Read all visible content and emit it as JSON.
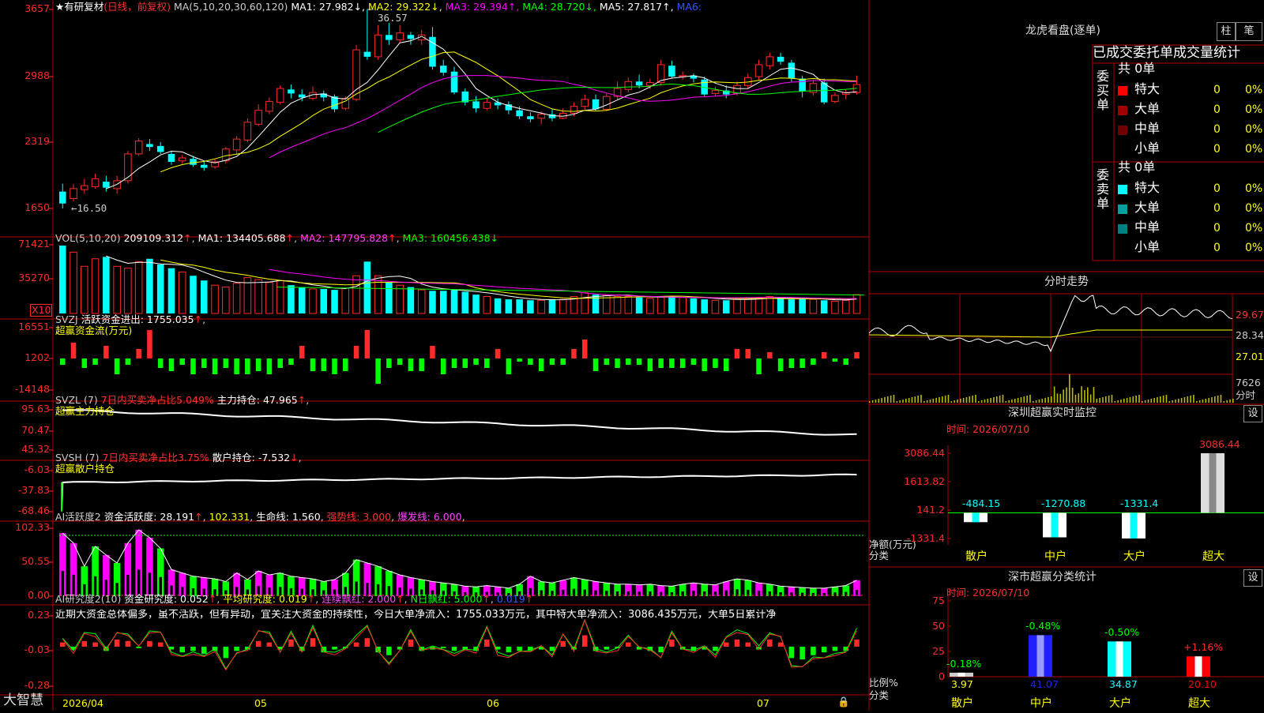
{
  "app": {
    "brand": "大智慧"
  },
  "colors": {
    "up": "#ff2a2a",
    "down": "#00ffff",
    "frame": "#b00000",
    "text": "#c0c0c0",
    "yellow": "#ffff00",
    "magenta": "#ff00ff",
    "green": "#00ff00",
    "white": "#ffffff"
  },
  "kline": {
    "title": "★有研复材",
    "subtitle": "(日线，前复权)",
    "ma_params": "MA(5,10,20,30,60,120)",
    "ma": [
      {
        "label": "MA1: 27.982",
        "arrow": "↓",
        "color": "#ffffff"
      },
      {
        "label": "MA2: 29.322",
        "arrow": "↓",
        "color": "#ffff00"
      },
      {
        "label": "MA3: 29.394",
        "arrow": "↑",
        "color": "#ff00ff"
      },
      {
        "label": "MA4: 28.720",
        "arrow": "↓",
        "color": "#00ff00"
      },
      {
        "label": "MA5: 27.817",
        "arrow": "↑",
        "color": "#ffffff"
      },
      {
        "label": "MA6:",
        "arrow": "",
        "color": "#3355ff"
      }
    ],
    "y_labels": [
      "3657",
      "2988",
      "2319",
      "1650"
    ],
    "high_mark": "36.57",
    "low_mark": "←16.50"
  },
  "vol": {
    "header": "VOL(5,10,20)",
    "value": "209109.312",
    "ma1": "MA1: 134405.688",
    "ma2": "MA2: 147795.828",
    "ma3": "MA3: 160456.438",
    "y_labels": [
      "71421",
      "35270"
    ],
    "unit": "X10"
  },
  "svzj": {
    "header": "SVZJ",
    "item": "活跃资金进出: 1755.035",
    "sub": "超赢资金流(万元)",
    "y_labels": [
      "16551",
      "1202",
      "-14148"
    ]
  },
  "svzl": {
    "header": "SVZL (7)",
    "item1": "7日内买卖净占比5.049%",
    "item2": "主力持仓: 47.965",
    "sub": "超赢主力持仓",
    "y_labels": [
      "95.63",
      "70.47",
      "45.32"
    ]
  },
  "svsh": {
    "header": "SVSH (7)",
    "item1": "7日内买卖净占比3.75%",
    "item2": "散户持仓: -7.532",
    "sub": "超赢散户持仓",
    "y_labels": [
      "-6.03",
      "-37.83",
      "-68.46"
    ]
  },
  "ai1": {
    "header": "AI活跃度2",
    "item1": "资金活跃度: 28.191",
    "item2": "102.331",
    "item3": "生命线: 1.560",
    "item4": "强势线: 3.000",
    "item5": "爆发线: 6.000",
    "y_labels": [
      "102.33",
      "50.55",
      "0.00"
    ]
  },
  "ai2": {
    "header": "AI研究度2(10)",
    "item1": "资金研究度: 0.052",
    "item2": "平均研究度: 0.019",
    "item3": "连续飘红: 2.000",
    "item4": "N日飘红: 5.000",
    "item5": "0.019",
    "comment": "近期大资金总体偏多，虽不活跃，但有异动，宜关注大资金的持续性，今日大单净流入：1755.033万元，其中特大单净流入：3086.435万元，大单5日累计净",
    "y_labels": [
      "0.23",
      "-0.03",
      "-0.28"
    ]
  },
  "xaxis": {
    "labels": [
      "2026/04",
      "05",
      "06",
      "07"
    ]
  },
  "lhb": {
    "title": "龙虎看盘(逐单)",
    "tabs": [
      "柱",
      "笔"
    ],
    "header": "已成交委托单成交量统计",
    "buy": {
      "label": "委买单",
      "total": "共 0单",
      "rows": [
        {
          "name": "特大",
          "count": "0",
          "pct": "0%",
          "color": "#ff0000"
        },
        {
          "name": "大单",
          "count": "0",
          "pct": "0%",
          "color": "#a00000"
        },
        {
          "name": "中单",
          "count": "0",
          "pct": "0%",
          "color": "#700000"
        },
        {
          "name": "小单",
          "count": "0",
          "pct": "0%",
          "color": ""
        }
      ]
    },
    "sell": {
      "label": "委卖单",
      "total": "共 0单",
      "rows": [
        {
          "name": "特大",
          "count": "0",
          "pct": "0%",
          "color": "#00ffff"
        },
        {
          "name": "大单",
          "count": "0",
          "pct": "0%",
          "color": "#00a0a0"
        },
        {
          "name": "中单",
          "count": "0",
          "pct": "0%",
          "color": "#008080"
        },
        {
          "name": "小单",
          "count": "0",
          "pct": "0%",
          "color": ""
        }
      ]
    }
  },
  "fenshi": {
    "title": "分时走势",
    "y_labels": [
      "29.67",
      "28.34",
      "27.01"
    ],
    "vol_label": "7626",
    "unit": "分时"
  },
  "sz_monitor": {
    "title": "深圳超赢实时监控",
    "set": "设",
    "time": "时间: 2026/07/10",
    "y_labels": [
      "3086.44",
      "1613.82",
      "141.2",
      "-1331.4"
    ],
    "ylabel": "净额(万元)",
    "xlabel": "分类",
    "categories": [
      "散户",
      "中户",
      "大户",
      "超大"
    ],
    "values": [
      -484.15,
      -1270.88,
      -1331.4,
      3086.44
    ],
    "value_labels": [
      "-484.15",
      "-1270.88",
      "-1331.4",
      "3086.44"
    ]
  },
  "sz_stats": {
    "title": "深市超赢分类统计",
    "set": "设",
    "time": "时间: 2026/07/10",
    "y_labels": [
      "75",
      "50",
      "25",
      "0"
    ],
    "ylabel": "比例%",
    "xlabel": "分类",
    "categories": [
      "散户",
      "中户",
      "大户",
      "超大"
    ],
    "values": [
      3.97,
      41.07,
      34.87,
      20.1
    ],
    "value_labels": [
      "3.97",
      "41.07",
      "34.87",
      "20.10"
    ],
    "change_labels": [
      "-0.18%",
      "-0.48%",
      "-0.50%",
      "+1.16%"
    ],
    "bar_colors": [
      "#cccccc",
      "#2020ff",
      "#00ffff",
      "#ff0000"
    ]
  },
  "chart_data": [
    {
      "type": "candlestick",
      "title": "★有研复材",
      "ylim": [
        16.5,
        36.57
      ],
      "candles": [
        [
          18.2,
          17.0,
          19.0,
          16.5
        ],
        [
          17.5,
          18.5,
          19.0,
          17.2
        ],
        [
          18.4,
          18.8,
          19.5,
          18.0
        ],
        [
          18.7,
          19.5,
          20.0,
          18.5
        ],
        [
          19.2,
          18.6,
          19.8,
          18.2
        ],
        [
          18.5,
          19.3,
          19.8,
          18.0
        ],
        [
          19.3,
          22.0,
          22.3,
          19.0
        ],
        [
          22.0,
          23.3,
          23.6,
          21.8
        ],
        [
          23.0,
          22.7,
          23.5,
          22.3
        ],
        [
          22.8,
          22.2,
          23.2,
          22.0
        ],
        [
          22.0,
          21.2,
          22.3,
          20.9
        ],
        [
          21.3,
          21.6,
          21.9,
          21.0
        ],
        [
          21.5,
          20.9,
          21.8,
          20.7
        ],
        [
          20.9,
          20.6,
          21.3,
          20.3
        ],
        [
          20.7,
          21.2,
          21.5,
          20.5
        ],
        [
          21.3,
          22.5,
          22.7,
          21.0
        ],
        [
          22.4,
          23.5,
          23.8,
          22.0
        ],
        [
          23.4,
          25.2,
          25.6,
          23.2
        ],
        [
          25.0,
          26.4,
          27.0,
          24.8
        ],
        [
          26.3,
          27.3,
          27.7,
          26.0
        ],
        [
          27.2,
          28.6,
          28.9,
          27.0
        ],
        [
          28.5,
          28.1,
          29.0,
          27.6
        ],
        [
          28.0,
          27.7,
          28.5,
          27.3
        ],
        [
          27.6,
          28.2,
          28.8,
          27.4
        ],
        [
          28.1,
          27.7,
          28.4,
          27.3
        ],
        [
          27.8,
          26.5,
          28.0,
          26.2
        ],
        [
          26.6,
          27.6,
          27.8,
          26.4
        ],
        [
          27.5,
          32.5,
          33.0,
          27.3
        ],
        [
          32.3,
          31.8,
          36.57,
          31.5
        ],
        [
          31.8,
          34.0,
          35.0,
          31.5
        ],
        [
          34.0,
          33.5,
          35.2,
          33.0
        ],
        [
          33.5,
          34.2,
          35.0,
          33.2
        ],
        [
          34.0,
          33.6,
          34.3,
          33.0
        ],
        [
          33.5,
          34.0,
          34.5,
          33.0
        ],
        [
          33.8,
          30.8,
          34.8,
          30.5
        ],
        [
          30.9,
          30.2,
          31.5,
          29.9
        ],
        [
          30.3,
          28.2,
          30.8,
          28.0
        ],
        [
          28.3,
          27.2,
          28.6,
          26.9
        ],
        [
          27.3,
          26.6,
          27.8,
          26.2
        ],
        [
          26.6,
          27.2,
          27.6,
          26.4
        ],
        [
          27.2,
          26.9,
          27.6,
          26.5
        ],
        [
          27.0,
          26.4,
          27.3,
          26.0
        ],
        [
          26.4,
          25.8,
          26.8,
          25.5
        ],
        [
          25.8,
          25.5,
          26.2,
          25.2
        ],
        [
          25.6,
          26.0,
          26.3,
          25.0
        ],
        [
          26.0,
          25.6,
          26.5,
          25.3
        ],
        [
          25.6,
          26.1,
          26.6,
          25.5
        ],
        [
          26.1,
          26.8,
          27.2,
          25.8
        ],
        [
          26.8,
          27.5,
          28.0,
          26.5
        ],
        [
          27.5,
          26.5,
          28.0,
          26.3
        ],
        [
          26.5,
          27.8,
          28.1,
          26.3
        ],
        [
          27.8,
          28.6,
          29.3,
          27.5
        ],
        [
          28.5,
          29.3,
          29.7,
          28.2
        ],
        [
          29.3,
          28.9,
          30.0,
          28.6
        ],
        [
          28.9,
          29.2,
          29.6,
          28.5
        ],
        [
          29.2,
          31.0,
          31.5,
          28.9
        ],
        [
          30.9,
          29.8,
          31.4,
          29.6
        ],
        [
          29.8,
          29.9,
          30.3,
          29.5
        ],
        [
          29.9,
          29.6,
          30.1,
          29.2
        ],
        [
          29.5,
          28.0,
          29.8,
          27.8
        ],
        [
          28.1,
          28.4,
          28.8,
          27.8
        ],
        [
          28.4,
          28.0,
          28.9,
          27.6
        ],
        [
          28.1,
          28.9,
          29.3,
          27.9
        ],
        [
          28.9,
          29.7,
          30.1,
          28.6
        ],
        [
          29.8,
          31.0,
          31.5,
          29.5
        ],
        [
          30.9,
          31.8,
          32.2,
          30.5
        ],
        [
          31.8,
          31.3,
          32.2,
          31.0
        ],
        [
          31.2,
          29.6,
          31.5,
          29.3
        ],
        [
          29.6,
          28.3,
          29.9,
          27.7
        ],
        [
          28.2,
          29.1,
          29.5,
          27.9
        ],
        [
          29.2,
          27.2,
          29.6,
          27.0
        ],
        [
          27.3,
          27.9,
          28.2,
          27.1
        ],
        [
          28.0,
          28.2,
          28.5,
          27.5
        ],
        [
          28.2,
          29.0,
          29.9,
          28.0
        ]
      ]
    },
    {
      "type": "bar",
      "title": "VOL(5,10,20)",
      "ylim": [
        0,
        71421
      ],
      "values": [
        72000,
        65000,
        50000,
        58000,
        60000,
        50000,
        48000,
        55000,
        58000,
        52000,
        48000,
        44000,
        40000,
        35000,
        30000,
        28000,
        32000,
        38000,
        36000,
        33000,
        35000,
        30000,
        28000,
        26000,
        26000,
        25000,
        27000,
        40000,
        55000,
        40000,
        33000,
        30000,
        28000,
        25000,
        24000,
        24000,
        25000,
        23000,
        20000,
        18000,
        16000,
        15000,
        15000,
        14000,
        14000,
        15000,
        15000,
        18000,
        22000,
        20000,
        19000,
        18000,
        18000,
        17000,
        16000,
        18000,
        18000,
        17000,
        16000,
        15000,
        14000,
        14000,
        15000,
        16000,
        17000,
        18000,
        16000,
        15000,
        16000,
        15000,
        14000,
        13000,
        14000,
        20000
      ]
    }
  ]
}
